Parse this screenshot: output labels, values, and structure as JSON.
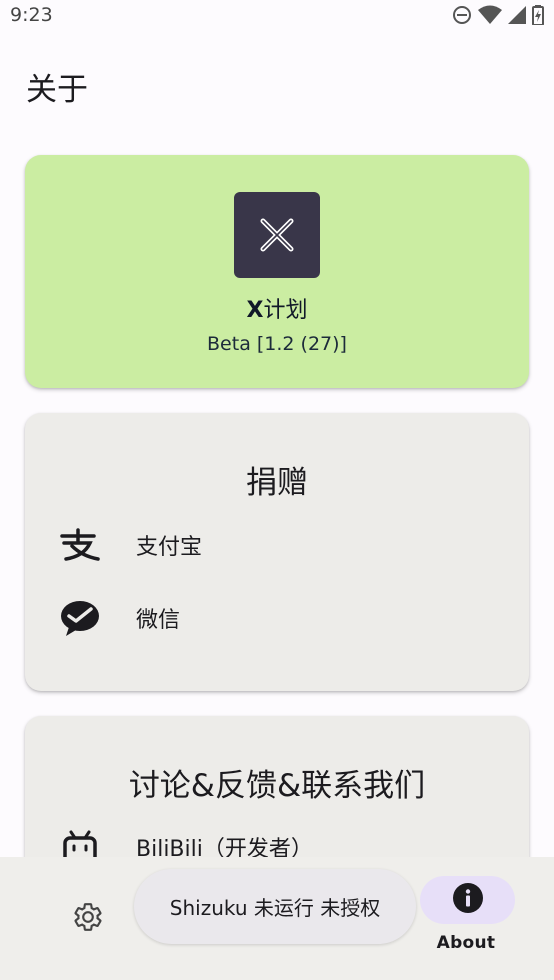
{
  "status_bar": {
    "time": "9:23",
    "icons": [
      "do-not-disturb-icon",
      "wifi-icon",
      "signal-icon",
      "battery-charging-icon"
    ]
  },
  "page": {
    "title": "关于"
  },
  "app_card": {
    "icon": "x-logo-icon",
    "name_prefix": "X",
    "name_suffix": "计划",
    "version": "Beta [1.2 (27)]",
    "background": "#cbeda2"
  },
  "donate_card": {
    "heading": "捐赠",
    "items": [
      {
        "label": "支付宝",
        "icon": "alipay-icon"
      },
      {
        "label": "微信",
        "icon": "wechat-icon"
      }
    ]
  },
  "contact_card": {
    "heading": "讨论&反馈&联系我们",
    "items": [
      {
        "label": "BiliBili（开发者）",
        "icon": "bilibili-icon"
      }
    ]
  },
  "bottom_nav": {
    "settings_icon": "gear-icon",
    "toast": "Shizuku 未运行 未授权",
    "about_icon": "info-icon",
    "about_label": "About",
    "accent": "#e7dff8"
  }
}
